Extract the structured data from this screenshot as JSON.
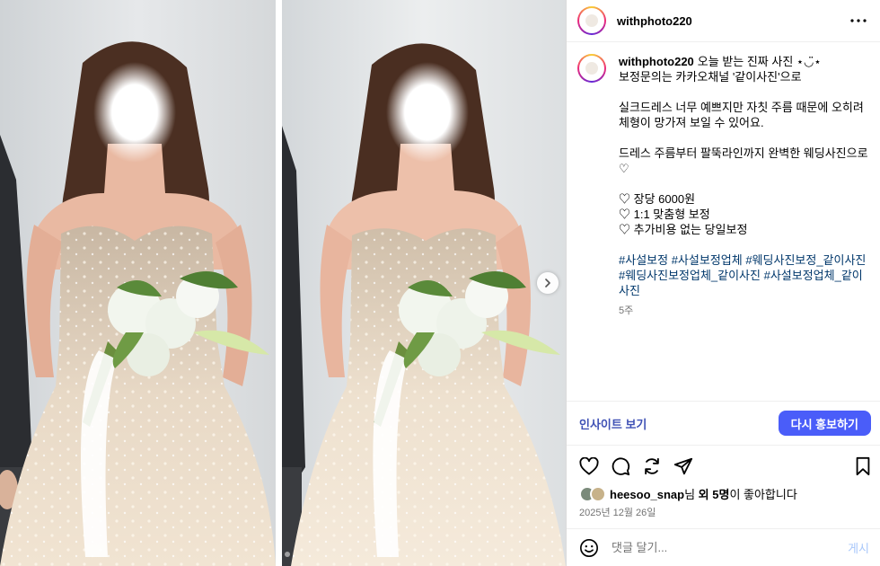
{
  "post": {
    "username": "withphoto220",
    "caption_lines": [
      "오늘 받는 진짜 사진 ⋆◡̈⋆",
      "보정문의는 카카오채널 '같이사진'으로",
      "",
      "실크드레스 너무 예쁘지만 자칫 주름 때문에 오히려",
      "체형이 망가져 보일 수 있어요.",
      "",
      "드레스 주름부터 팔뚝라인까지 완벽한 웨딩사진으로",
      "♡",
      "",
      "♡ 장당 6000원",
      "♡ 1:1 맞춤형 보정",
      "♡ 추가비용 없는 당일보정",
      ""
    ],
    "hashtags": [
      "#사설보정",
      "#사설보정업체",
      "#웨딩사진보정_같이사진",
      "#웨딩사진보정업체_같이사진",
      "#사설보정업체_같이사진"
    ],
    "time_ago": "5주",
    "date": "2025년 12월 26일"
  },
  "promo": {
    "insights_label": "인사이트 보기",
    "boost_label": "다시 홍보하기"
  },
  "likes": {
    "user": "heesoo_snap",
    "suffix_1": "님 ",
    "others": "외 5명",
    "suffix_2": "이 좋아합니다"
  },
  "comment": {
    "placeholder": "댓글 달기...",
    "post_label": "게시"
  },
  "carousel": {
    "slide_count": 2,
    "active_index": 0
  },
  "icons": {
    "more": "more-horizontal-icon",
    "next": "chevron-right-icon",
    "like": "heart-icon",
    "comment": "comment-bubble-icon",
    "repost": "repost-icon",
    "share": "send-icon",
    "save": "bookmark-icon",
    "emoji": "emoji-icon"
  },
  "colors": {
    "link": "#00376b",
    "accent": "#4a5df9",
    "insights": "#3f51b5",
    "muted": "#737373",
    "border": "#dbdbdb"
  }
}
